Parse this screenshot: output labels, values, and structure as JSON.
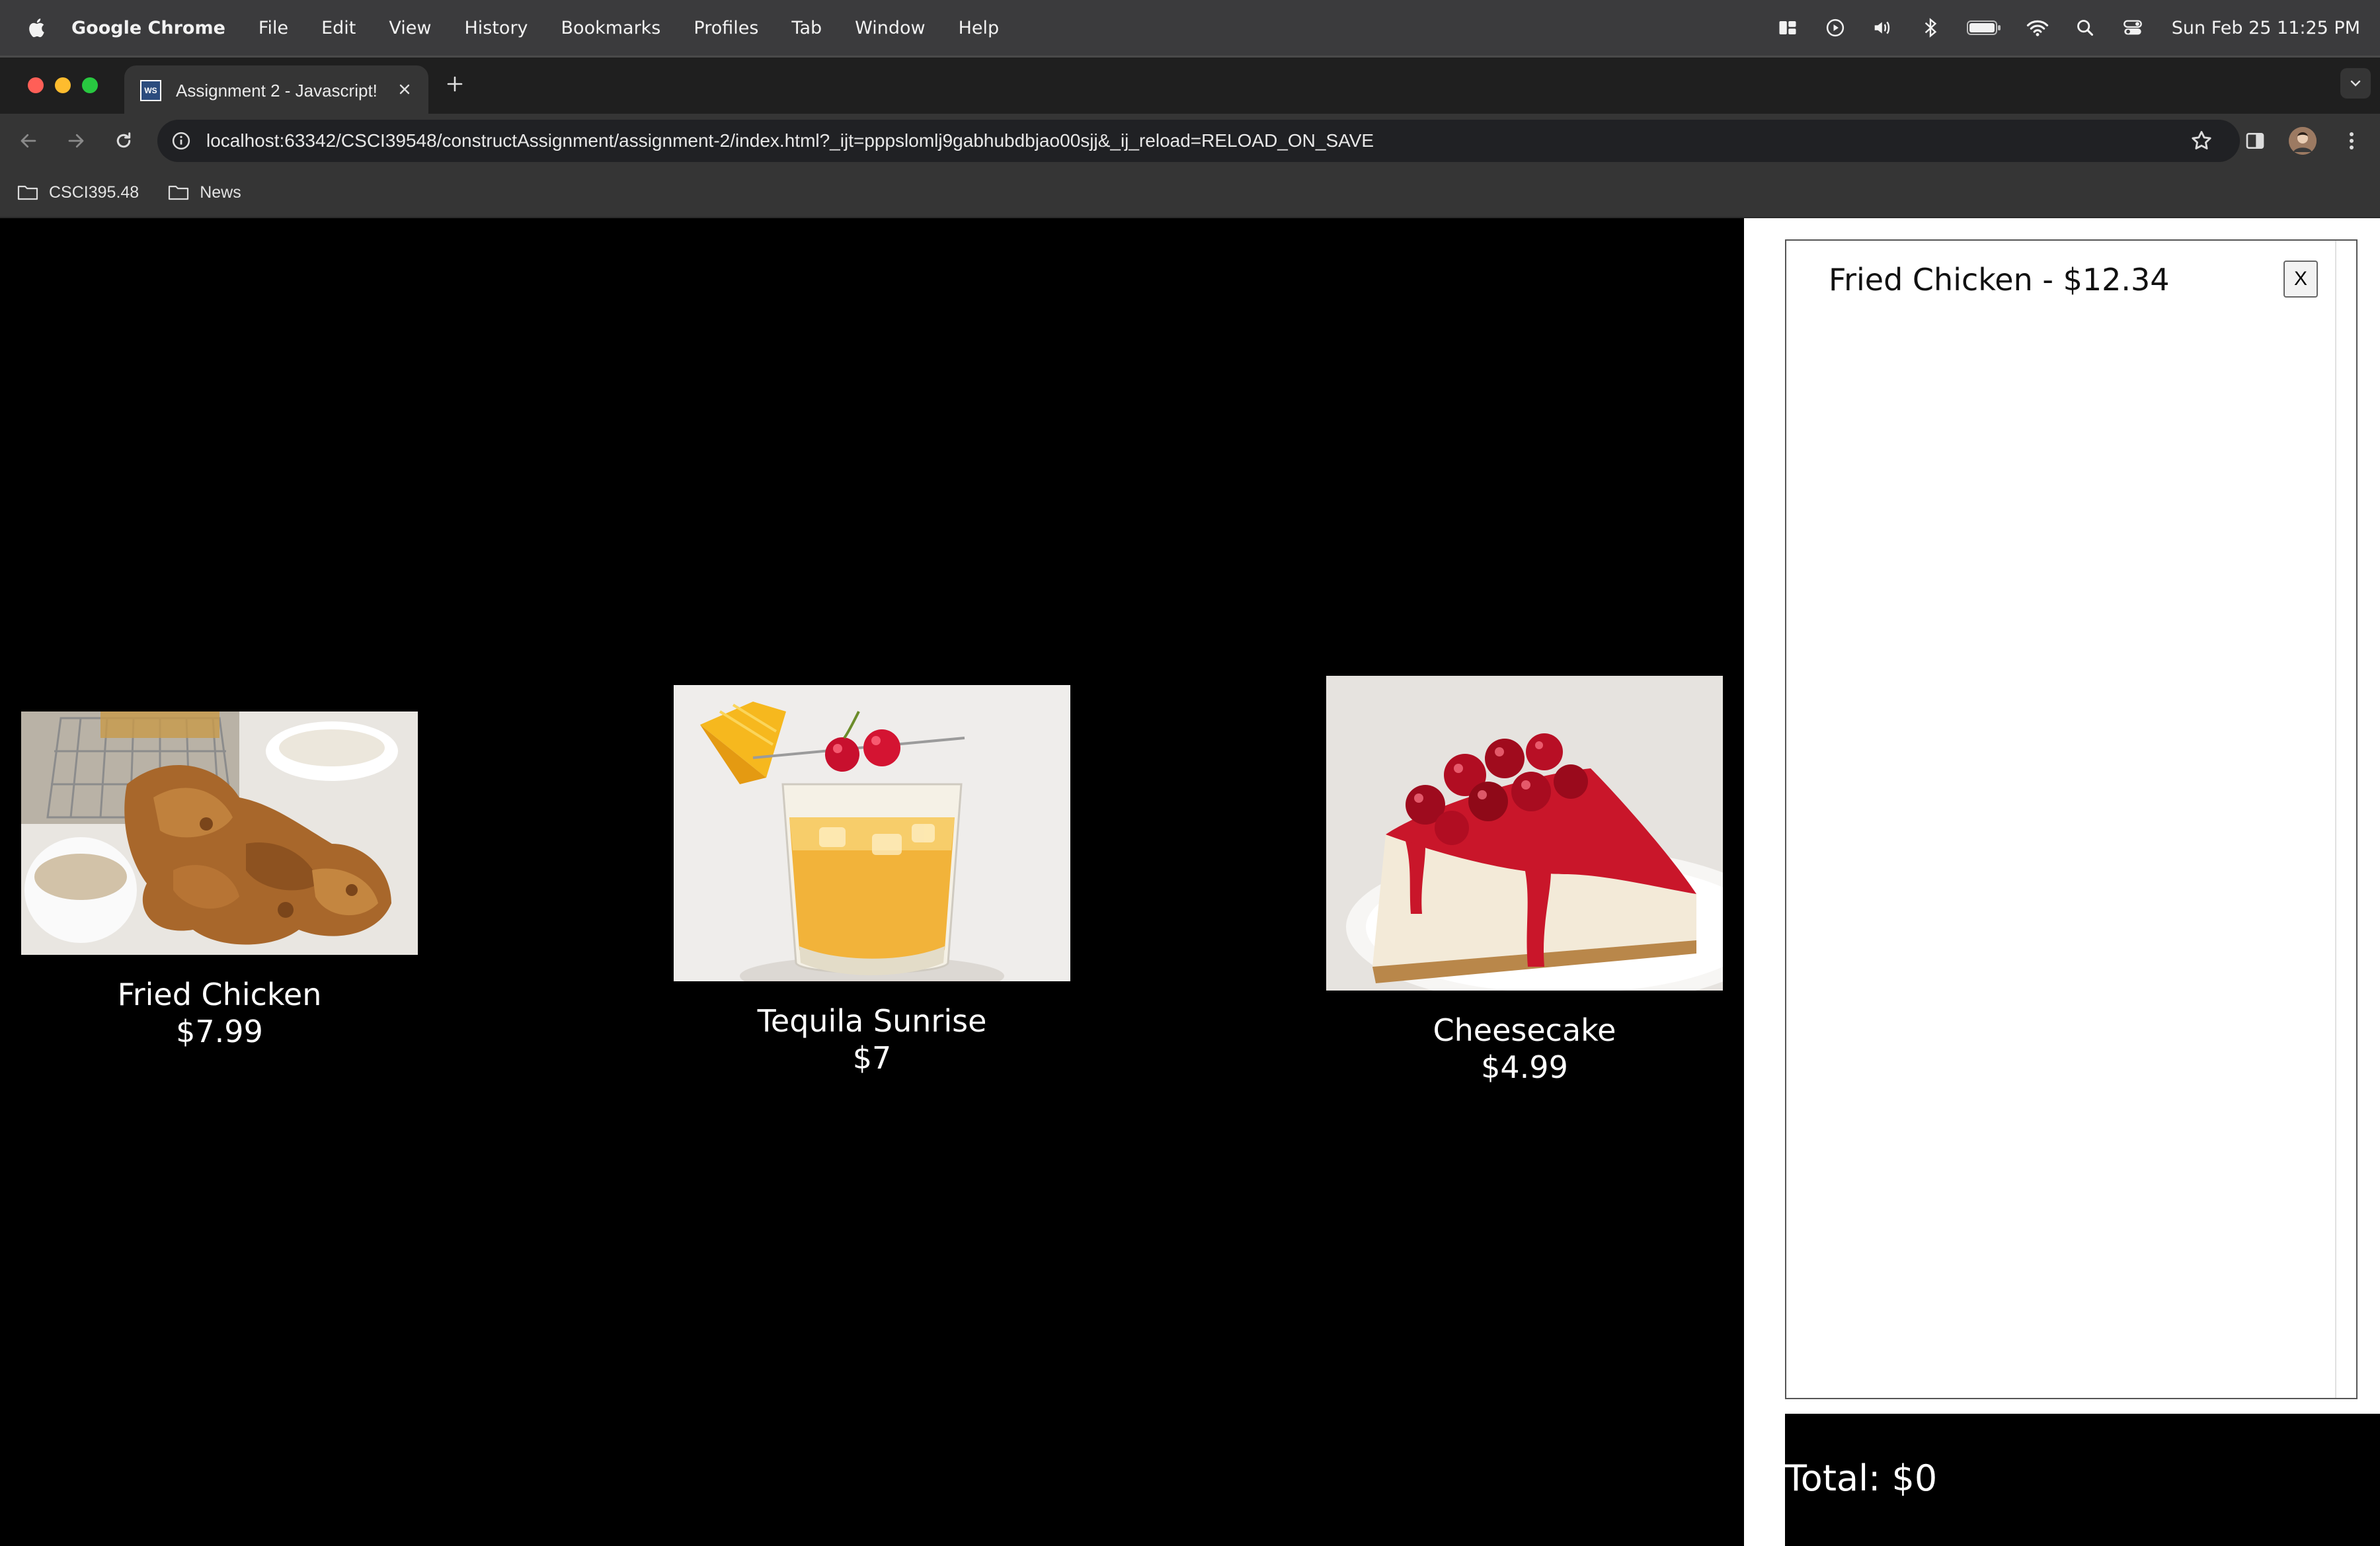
{
  "menubar": {
    "app_name": "Google Chrome",
    "items": [
      "File",
      "Edit",
      "View",
      "History",
      "Bookmarks",
      "Profiles",
      "Tab",
      "Window",
      "Help"
    ],
    "clock": "Sun Feb 25  11:25 PM"
  },
  "browser": {
    "tab_title": "Assignment 2 - Javascript!",
    "favicon_text": "WS",
    "url": "localhost:63342/CSCI39548/constructAssignment/assignment-2/index.html?_ijt=pppslomlj9gabhubdbjao00sjj&_ij_reload=RELOAD_ON_SAVE",
    "bookmarks": [
      "CSCI395.48",
      "News"
    ]
  },
  "menu_items": [
    {
      "name": "Fried Chicken",
      "price": "$7.99"
    },
    {
      "name": "Tequila Sunrise",
      "price": "$7"
    },
    {
      "name": "Cheesecake",
      "price": "$4.99"
    }
  ],
  "cart": {
    "items": [
      {
        "label": "Fried Chicken - $12.34",
        "remove_label": "X"
      }
    ],
    "total_label": "Total: $0"
  },
  "colors": {
    "menubar_bg": "#3b3b3d",
    "tabstrip_bg": "#1f1f1f",
    "toolbar_bg": "#353535",
    "page_bg": "#000000",
    "cart_bg": "#ffffff"
  }
}
